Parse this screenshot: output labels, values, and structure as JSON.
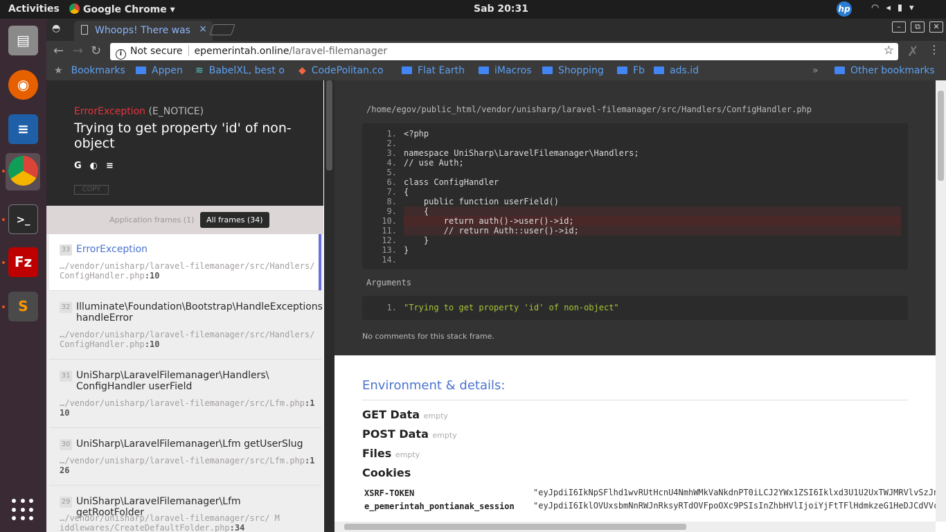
{
  "desktop": {
    "activities": "Activities",
    "app_name": "Google Chrome",
    "clock": "Sab 20:31",
    "hp_label": "hp",
    "tray_icons": [
      "wifi-icon",
      "volume-icon",
      "battery-icon",
      "menu-arrow-icon"
    ]
  },
  "dock": {
    "apps": [
      "files-icon",
      "firefox-icon",
      "writer-icon",
      "chrome-icon",
      "terminal-icon",
      "filezilla-icon",
      "sublime-icon"
    ],
    "colors": [
      "#8a8a8a",
      "#e66000",
      "#1f5fa8",
      "#ffffff",
      "#2b2b2b",
      "#bf0000",
      "#4a4a4a"
    ]
  },
  "tab": {
    "title": "Whoops! There was",
    "close": "×"
  },
  "toolbar": {
    "security": "Not secure",
    "url_host": "epemerintah.online",
    "url_path": "/laravel-filemanager"
  },
  "bookmarks": {
    "items": [
      "Bookmarks",
      "Appen",
      "BabelXL, best o",
      "CodePolitan.co",
      "Flat Earth",
      "iMacros",
      "Shopping",
      "Fb",
      "ads.id"
    ],
    "overflow": "»",
    "other": "Other bookmarks"
  },
  "error": {
    "class": "ErrorException",
    "type": "(E_NOTICE)",
    "message": "Trying to get property 'id' of non-object",
    "copy": "COPY"
  },
  "frame_tabs": {
    "app": "Application frames (1)",
    "all": "All frames (34)"
  },
  "frames": [
    {
      "num": "33",
      "cls": "ErrorException",
      "file": "…/vendor/unisharp/laravel-filemanager/src/Handlers/ConfigHandler.php",
      "line": ":10"
    },
    {
      "num": "32",
      "cls": "Illuminate\\Foundation\\Bootstrap\\HandleExceptions handleError",
      "file": "…/vendor/unisharp/laravel-filemanager/src/Handlers/ConfigHandler.php",
      "line": ":10"
    },
    {
      "num": "31",
      "cls": "UniSharp\\LaravelFilemanager\\Handlers\\ ConfigHandler userField",
      "file": "…/vendor/unisharp/laravel-filemanager/src/Lfm.php",
      "line": ":110"
    },
    {
      "num": "30",
      "cls": "UniSharp\\LaravelFilemanager\\Lfm getUserSlug",
      "file": "…/vendor/unisharp/laravel-filemanager/src/Lfm.php",
      "line": ":126"
    },
    {
      "num": "29",
      "cls": "UniSharp\\LaravelFilemanager\\Lfm getRootFolder",
      "file": "…/vendor/unisharp/laravel-filemanager/src/ Middlewares/CreateDefaultFolder.php",
      "line": ":34"
    }
  ],
  "detail": {
    "path": "/home/egov/public_html/vendor/unisharp/laravel-filemanager/src/Handlers/ConfigHandler.php",
    "line_numbers": [
      "1.",
      "2.",
      "3.",
      "4.",
      "5.",
      "6.",
      "7.",
      "8.",
      "9.",
      "10.",
      "11.",
      "12.",
      "13.",
      "14."
    ],
    "code": [
      "<?php",
      "",
      "namespace UniSharp\\LaravelFilemanager\\Handlers;",
      "// use Auth;",
      "",
      "class ConfigHandler",
      "{",
      "    public function userField()",
      "    {",
      "        return auth()->user()->id;",
      "        // return Auth::user()->id;",
      "    }",
      "}",
      ""
    ],
    "arguments_label": "Arguments",
    "arg_num": "1.",
    "arg_value": "\"Trying to get property 'id' of non-object\"",
    "no_comments": "No comments for this stack frame."
  },
  "env": {
    "heading": "Environment & details:",
    "sections": [
      {
        "name": "GET Data",
        "state": "empty"
      },
      {
        "name": "POST Data",
        "state": "empty"
      },
      {
        "name": "Files",
        "state": "empty"
      },
      {
        "name": "Cookies",
        "state": ""
      }
    ],
    "cookies": [
      {
        "key": "XSRF-TOKEN",
        "value": "\"eyJpdiI6IkNpSFlhd1wvRUtHcnU4NmhWMkVaNkdnPT0iLCJ2YWx1ZSI6Iklxd3U1U2UxTWJMRVlvSzJn"
      },
      {
        "key": "e_pemerintah_pontianak_session",
        "value": "\"eyJpdiI6IklOVUxsbmNnRWJnRksyRTdOVFpoOXc9PSIsInZhbHVlIjoiYjFtTFlHdmkzeG1HeDJCdVVc"
      }
    ]
  }
}
